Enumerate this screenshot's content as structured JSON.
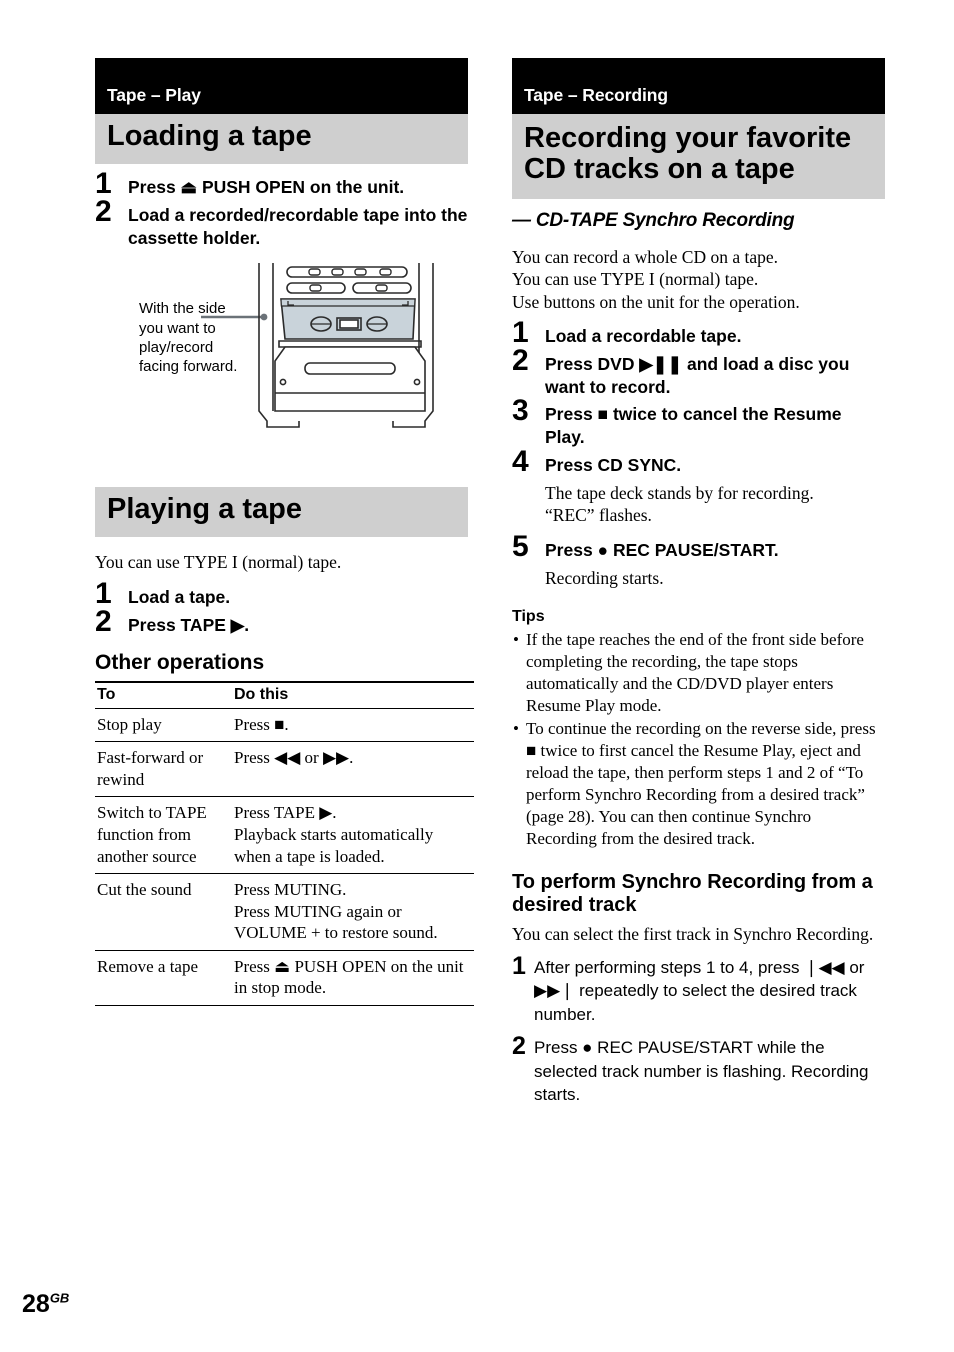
{
  "page": {
    "number": "28",
    "region_suffix": "GB"
  },
  "left_column": {
    "section_label": "Tape – Play",
    "title": "Loading a tape",
    "steps": [
      {
        "num": "1",
        "text": "Press ⏏ PUSH OPEN on the unit."
      },
      {
        "num": "2",
        "text": "Load a recorded/recordable tape into the cassette holder."
      }
    ],
    "figure": {
      "caption": "With the side you want to play/record facing forward.",
      "name": "cassette-deck-illustration"
    },
    "section2_title": "Playing a tape",
    "section2_intro": "You can use TYPE I (normal) tape.",
    "section2_steps": [
      {
        "num": "1",
        "text": "Load a tape."
      },
      {
        "num": "2",
        "text": "Press TAPE ▶."
      }
    ],
    "other_operations_heading": "Other operations",
    "table": {
      "headers": [
        "To",
        "Do this"
      ],
      "rows": [
        {
          "to": "Stop play",
          "do": "Press ■."
        },
        {
          "to": "Fast-forward or rewind",
          "do": "Press ◀◀ or ▶▶."
        },
        {
          "to": "Switch to TAPE function from another source",
          "do": "Press TAPE ▶.\nPlayback starts automatically when a tape is loaded."
        },
        {
          "to": "Cut the sound",
          "do": "Press MUTING.\nPress MUTING again or VOLUME + to restore sound."
        },
        {
          "to": "Remove a tape",
          "do": "Press ⏏ PUSH OPEN on the unit in stop mode."
        }
      ]
    }
  },
  "right_column": {
    "section_label": "Tape – Recording",
    "title": "Recording your favorite CD tracks on a tape",
    "subtitle": "— CD-TAPE Synchro Recording",
    "intro": "You can record a whole CD on a tape.\nYou can use TYPE I (normal) tape.\nUse buttons on the unit for the operation.",
    "steps": [
      {
        "num": "1",
        "text": "Load a recordable tape.",
        "note": ""
      },
      {
        "num": "2",
        "text": "Press DVD ▶❚❚ and load a disc you want to record.",
        "note": ""
      },
      {
        "num": "3",
        "text": "Press ■ twice to cancel the Resume Play.",
        "note": ""
      },
      {
        "num": "4",
        "text": "Press CD SYNC.",
        "note": "The tape deck stands by for recording.\n“REC” flashes."
      },
      {
        "num": "5",
        "text": "Press ● REC PAUSE/START.",
        "note": "Recording starts."
      }
    ],
    "tips_heading": "Tips",
    "tips": [
      "If the tape reaches the end of the front side before completing the recording, the tape stops automatically and the CD/DVD player enters Resume Play mode.",
      "To continue the recording on the reverse side, press ■ twice to first cancel the Resume Play, eject and reload the tape, then perform steps 1 and 2 of “To perform Synchro Recording from a desired track” (page 28). You can then continue Synchro Recording from the desired track."
    ],
    "sub_heading": "To perform Synchro Recording from a desired track",
    "sub_intro": "You can select the first track in Synchro Recording.",
    "sub_steps": [
      {
        "num": "1",
        "text": "After performing steps 1 to 4, press ❘◀◀ or ▶▶❘ repeatedly to select the desired track number."
      },
      {
        "num": "2",
        "text": "Press ● REC PAUSE/START while the selected track number is flashing. Recording starts."
      }
    ]
  },
  "colors": {
    "section_bar_bg": "#000000",
    "section_bar_fg": "#ffffff",
    "title_band_bg": "#cfcfcf",
    "cassette_fill": "#c9d3da"
  }
}
